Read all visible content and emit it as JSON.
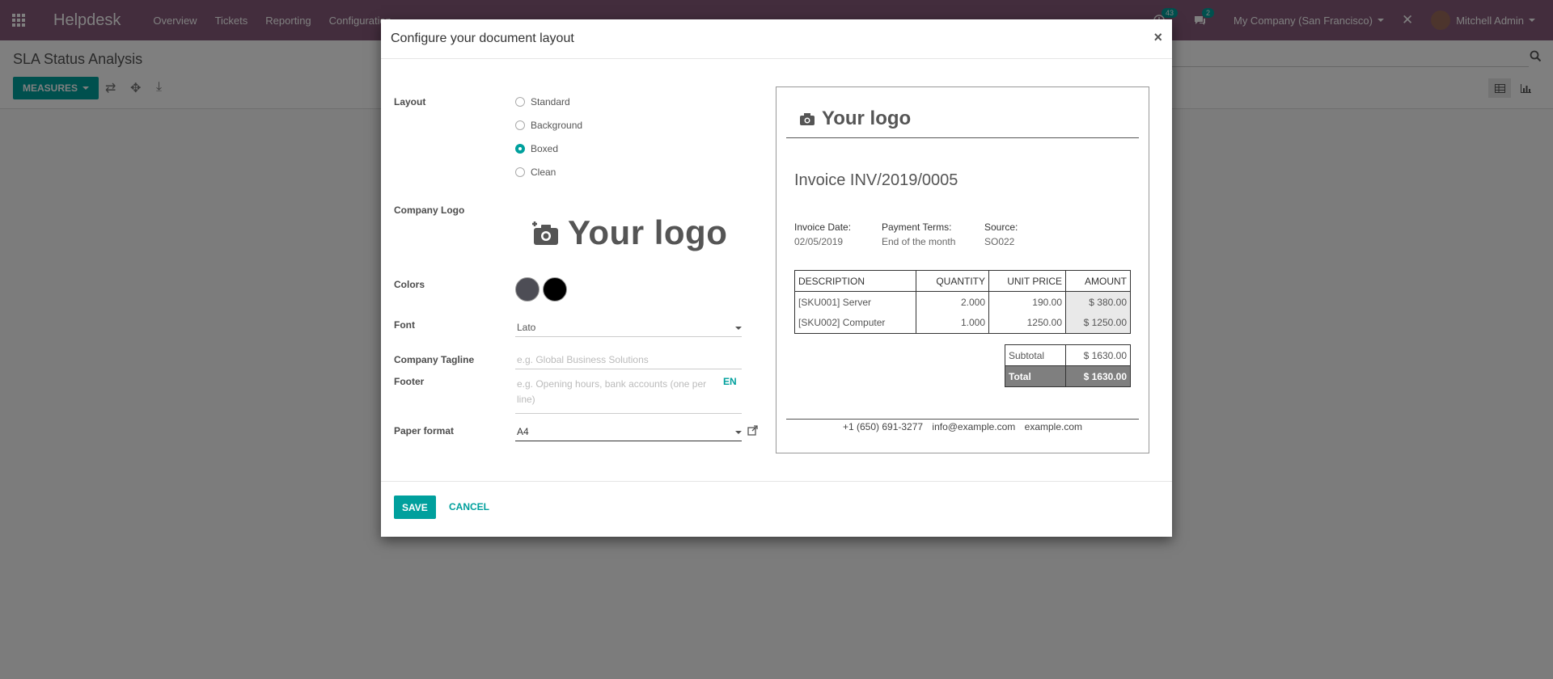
{
  "navbar": {
    "brand": "Helpdesk",
    "menu": [
      "Overview",
      "Tickets",
      "Reporting",
      "Configuration"
    ],
    "activity_count": "43",
    "message_count": "2",
    "company": "My Company (San Francisco)",
    "user": "Mitchell Admin"
  },
  "control_panel": {
    "title": "SLA Status Analysis",
    "measures_label": "MEASURES"
  },
  "modal": {
    "title": "Configure your document layout",
    "close": "×",
    "layout_label": "Layout",
    "layout_options": [
      "Standard",
      "Background",
      "Boxed",
      "Clean"
    ],
    "layout_selected": "Boxed",
    "company_logo_label": "Company Logo",
    "logo_text": "Your logo",
    "colors_label": "Colors",
    "color_primary": "#4d4d55",
    "color_secondary": "#000000",
    "font_label": "Font",
    "font_value": "Lato",
    "tagline_label": "Company Tagline",
    "tagline_placeholder": "e.g. Global Business Solutions",
    "footer_label": "Footer",
    "footer_placeholder_line1": "e.g. Opening hours, bank accounts (one per",
    "footer_placeholder_line2": "line)",
    "lang": "EN",
    "paper_label": "Paper format",
    "paper_value": "A4",
    "save": "SAVE",
    "cancel": "CANCEL"
  },
  "preview": {
    "logo_text": "Your logo",
    "invoice_title": "Invoice INV/2019/0005",
    "meta": [
      {
        "label": "Invoice Date:",
        "value": "02/05/2019"
      },
      {
        "label": "Payment Terms:",
        "value": "End of the month"
      },
      {
        "label": "Source:",
        "value": "SO022"
      }
    ],
    "columns": [
      "DESCRIPTION",
      "QUANTITY",
      "UNIT PRICE",
      "AMOUNT"
    ],
    "rows": [
      {
        "desc": "[SKU001] Server",
        "qty": "2.000",
        "price": "190.00",
        "amount": "$ 380.00"
      },
      {
        "desc": "[SKU002] Computer",
        "qty": "1.000",
        "price": "1250.00",
        "amount": "$ 1250.00"
      }
    ],
    "subtotal_label": "Subtotal",
    "subtotal_value": "$ 1630.00",
    "total_label": "Total",
    "total_value": "$ 1630.00",
    "footer_phone": "+1 (650) 691-3277",
    "footer_email": "info@example.com",
    "footer_web": "example.com"
  },
  "colors": {
    "navbar": "#875a7b",
    "accent": "#00a09d"
  }
}
